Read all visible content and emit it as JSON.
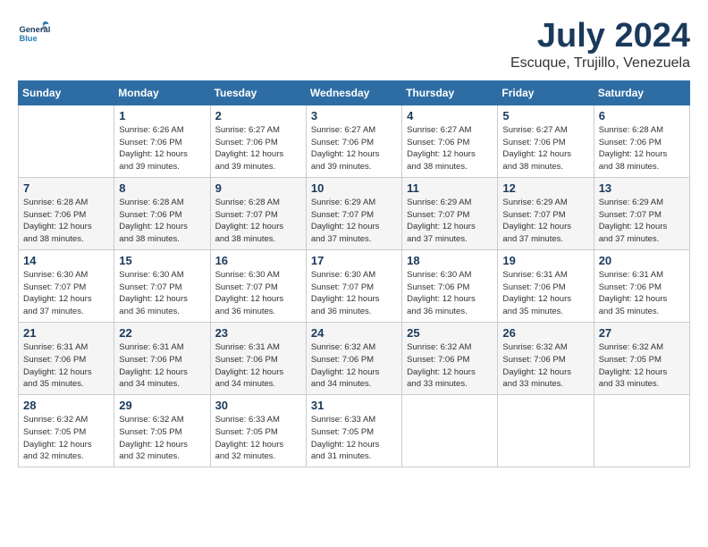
{
  "logo": {
    "text_general": "General",
    "text_blue": "Blue"
  },
  "title": {
    "month_year": "July 2024",
    "location": "Escuque, Trujillo, Venezuela"
  },
  "days_of_week": [
    "Sunday",
    "Monday",
    "Tuesday",
    "Wednesday",
    "Thursday",
    "Friday",
    "Saturday"
  ],
  "weeks": [
    [
      {
        "day": "",
        "info": ""
      },
      {
        "day": "1",
        "info": "Sunrise: 6:26 AM\nSunset: 7:06 PM\nDaylight: 12 hours\nand 39 minutes."
      },
      {
        "day": "2",
        "info": "Sunrise: 6:27 AM\nSunset: 7:06 PM\nDaylight: 12 hours\nand 39 minutes."
      },
      {
        "day": "3",
        "info": "Sunrise: 6:27 AM\nSunset: 7:06 PM\nDaylight: 12 hours\nand 39 minutes."
      },
      {
        "day": "4",
        "info": "Sunrise: 6:27 AM\nSunset: 7:06 PM\nDaylight: 12 hours\nand 38 minutes."
      },
      {
        "day": "5",
        "info": "Sunrise: 6:27 AM\nSunset: 7:06 PM\nDaylight: 12 hours\nand 38 minutes."
      },
      {
        "day": "6",
        "info": "Sunrise: 6:28 AM\nSunset: 7:06 PM\nDaylight: 12 hours\nand 38 minutes."
      }
    ],
    [
      {
        "day": "7",
        "info": "Sunrise: 6:28 AM\nSunset: 7:06 PM\nDaylight: 12 hours\nand 38 minutes."
      },
      {
        "day": "8",
        "info": "Sunrise: 6:28 AM\nSunset: 7:06 PM\nDaylight: 12 hours\nand 38 minutes."
      },
      {
        "day": "9",
        "info": "Sunrise: 6:28 AM\nSunset: 7:07 PM\nDaylight: 12 hours\nand 38 minutes."
      },
      {
        "day": "10",
        "info": "Sunrise: 6:29 AM\nSunset: 7:07 PM\nDaylight: 12 hours\nand 37 minutes."
      },
      {
        "day": "11",
        "info": "Sunrise: 6:29 AM\nSunset: 7:07 PM\nDaylight: 12 hours\nand 37 minutes."
      },
      {
        "day": "12",
        "info": "Sunrise: 6:29 AM\nSunset: 7:07 PM\nDaylight: 12 hours\nand 37 minutes."
      },
      {
        "day": "13",
        "info": "Sunrise: 6:29 AM\nSunset: 7:07 PM\nDaylight: 12 hours\nand 37 minutes."
      }
    ],
    [
      {
        "day": "14",
        "info": "Sunrise: 6:30 AM\nSunset: 7:07 PM\nDaylight: 12 hours\nand 37 minutes."
      },
      {
        "day": "15",
        "info": "Sunrise: 6:30 AM\nSunset: 7:07 PM\nDaylight: 12 hours\nand 36 minutes."
      },
      {
        "day": "16",
        "info": "Sunrise: 6:30 AM\nSunset: 7:07 PM\nDaylight: 12 hours\nand 36 minutes."
      },
      {
        "day": "17",
        "info": "Sunrise: 6:30 AM\nSunset: 7:07 PM\nDaylight: 12 hours\nand 36 minutes."
      },
      {
        "day": "18",
        "info": "Sunrise: 6:30 AM\nSunset: 7:06 PM\nDaylight: 12 hours\nand 36 minutes."
      },
      {
        "day": "19",
        "info": "Sunrise: 6:31 AM\nSunset: 7:06 PM\nDaylight: 12 hours\nand 35 minutes."
      },
      {
        "day": "20",
        "info": "Sunrise: 6:31 AM\nSunset: 7:06 PM\nDaylight: 12 hours\nand 35 minutes."
      }
    ],
    [
      {
        "day": "21",
        "info": "Sunrise: 6:31 AM\nSunset: 7:06 PM\nDaylight: 12 hours\nand 35 minutes."
      },
      {
        "day": "22",
        "info": "Sunrise: 6:31 AM\nSunset: 7:06 PM\nDaylight: 12 hours\nand 34 minutes."
      },
      {
        "day": "23",
        "info": "Sunrise: 6:31 AM\nSunset: 7:06 PM\nDaylight: 12 hours\nand 34 minutes."
      },
      {
        "day": "24",
        "info": "Sunrise: 6:32 AM\nSunset: 7:06 PM\nDaylight: 12 hours\nand 34 minutes."
      },
      {
        "day": "25",
        "info": "Sunrise: 6:32 AM\nSunset: 7:06 PM\nDaylight: 12 hours\nand 33 minutes."
      },
      {
        "day": "26",
        "info": "Sunrise: 6:32 AM\nSunset: 7:06 PM\nDaylight: 12 hours\nand 33 minutes."
      },
      {
        "day": "27",
        "info": "Sunrise: 6:32 AM\nSunset: 7:05 PM\nDaylight: 12 hours\nand 33 minutes."
      }
    ],
    [
      {
        "day": "28",
        "info": "Sunrise: 6:32 AM\nSunset: 7:05 PM\nDaylight: 12 hours\nand 32 minutes."
      },
      {
        "day": "29",
        "info": "Sunrise: 6:32 AM\nSunset: 7:05 PM\nDaylight: 12 hours\nand 32 minutes."
      },
      {
        "day": "30",
        "info": "Sunrise: 6:33 AM\nSunset: 7:05 PM\nDaylight: 12 hours\nand 32 minutes."
      },
      {
        "day": "31",
        "info": "Sunrise: 6:33 AM\nSunset: 7:05 PM\nDaylight: 12 hours\nand 31 minutes."
      },
      {
        "day": "",
        "info": ""
      },
      {
        "day": "",
        "info": ""
      },
      {
        "day": "",
        "info": ""
      }
    ]
  ]
}
